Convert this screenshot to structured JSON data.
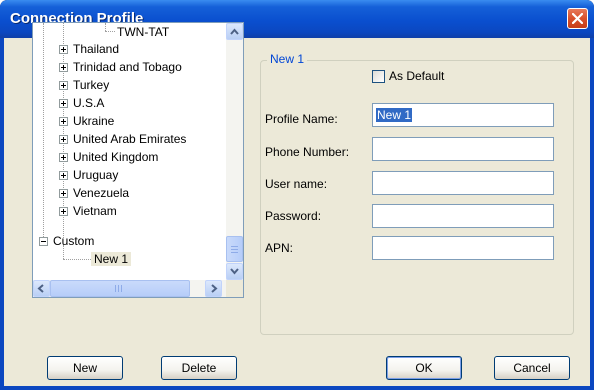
{
  "window": {
    "title": "Connection Profile"
  },
  "tree": {
    "items": [
      {
        "label": "TWN-TAT",
        "level": "leaf"
      },
      {
        "label": "Thailand",
        "level": "country"
      },
      {
        "label": "Trinidad and Tobago",
        "level": "country"
      },
      {
        "label": "Turkey",
        "level": "country"
      },
      {
        "label": "U.S.A",
        "level": "country"
      },
      {
        "label": "Ukraine",
        "level": "country"
      },
      {
        "label": "United Arab Emirates",
        "level": "country"
      },
      {
        "label": "United Kingdom",
        "level": "country"
      },
      {
        "label": "Uruguay",
        "level": "country"
      },
      {
        "label": "Venezuela",
        "level": "country"
      },
      {
        "label": "Vietnam",
        "level": "country"
      },
      {
        "label": "Custom",
        "level": "root-expanded"
      },
      {
        "label": "New 1",
        "level": "leaf-selected"
      }
    ]
  },
  "profile": {
    "group_title": "New 1",
    "as_default_label": "As Default",
    "as_default_checked": false,
    "fields": {
      "profile_name": {
        "label": "Profile Name:",
        "value": "New 1"
      },
      "phone_number": {
        "label": "Phone Number:",
        "value": ""
      },
      "user_name": {
        "label": "User name:",
        "value": ""
      },
      "password": {
        "label": "Password:",
        "value": ""
      },
      "apn": {
        "label": "APN:",
        "value": ""
      }
    }
  },
  "buttons": {
    "new": "New",
    "delete": "Delete",
    "ok": "OK",
    "cancel": "Cancel"
  },
  "colors": {
    "title_bar": "#0a4fcf",
    "close_button": "#d8502c",
    "selection": "#316ac5",
    "group_title": "#0046d5",
    "dialog_bg": "#ece9d8"
  }
}
